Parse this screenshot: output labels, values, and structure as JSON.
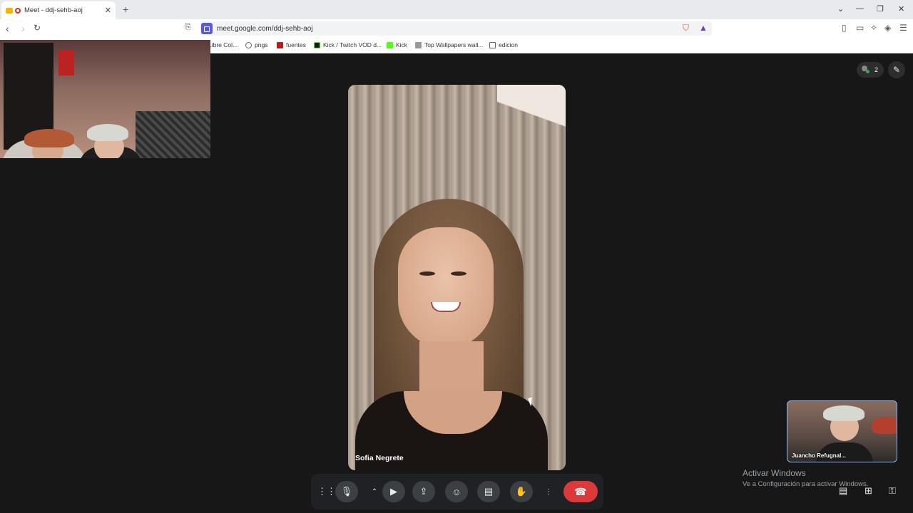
{
  "browser": {
    "tab_title": "Meet - ddj-sehb-aoj",
    "url": "meet.google.com/ddj-sehb-aoj",
    "bookmarks": [
      {
        "label": "Libre Col...",
        "icon": "bookmark-generic-icon"
      },
      {
        "label": "pngs",
        "icon": "pngs-icon"
      },
      {
        "label": "fuentes",
        "icon": "dafont-icon"
      },
      {
        "label": "Kick / Twitch VOD d...",
        "icon": "kick-icon"
      },
      {
        "label": "Kick",
        "icon": "kick-icon"
      },
      {
        "label": "Top Wallpapers wall...",
        "icon": "wallpaper-icon"
      },
      {
        "label": "edicion",
        "icon": "folder-icon"
      }
    ]
  },
  "meet": {
    "participants_count": "2",
    "main_participant_name": "Sofia Negrete",
    "self_name": "Juancho Refugnal...",
    "controls": [
      "audio-levels",
      "mic",
      "more-options-chevron",
      "camera",
      "present",
      "emoji",
      "captions",
      "raise-hand",
      "more",
      "end-call"
    ]
  },
  "watermark": {
    "title": "Activar Windows",
    "subtitle": "Ve a Configuración para activar Windows."
  },
  "colors": {
    "end_call": "#dc3a3a",
    "stage_bg": "#171717",
    "control_bg": "#3c4043",
    "self_border": "#8ab4f8"
  }
}
